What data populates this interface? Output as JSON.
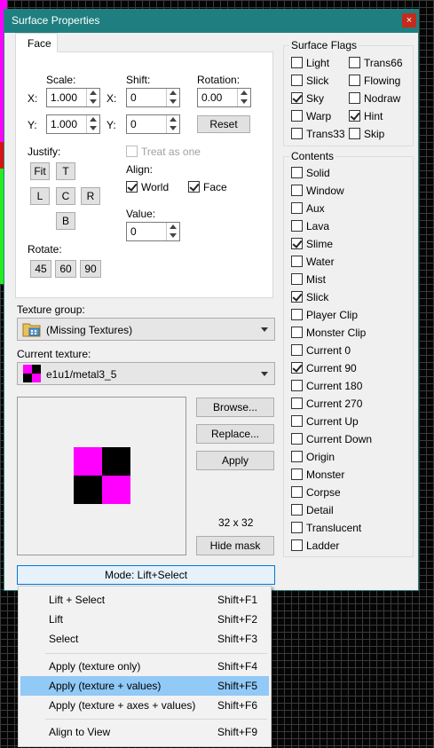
{
  "title": "Surface Properties",
  "close_glyph": "×",
  "tab_face": "Face",
  "scale": {
    "label": "Scale:",
    "x_label": "X:",
    "y_label": "Y:",
    "x_value": "1.000",
    "y_value": "1.000"
  },
  "shift": {
    "label": "Shift:",
    "x_label": "X:",
    "y_label": "Y:",
    "x_value": "0",
    "y_value": "0"
  },
  "rotation": {
    "label": "Rotation:",
    "value": "0.00"
  },
  "reset_label": "Reset",
  "justify": {
    "label": "Justify:",
    "fit": "Fit",
    "t": "T",
    "l": "L",
    "c": "C",
    "r": "R",
    "b": "B"
  },
  "treat_as_one": "Treat as one",
  "align": {
    "label": "Align:",
    "world": "World",
    "face": "Face"
  },
  "value": {
    "label": "Value:",
    "value": "0"
  },
  "rotate": {
    "label": "Rotate:",
    "r45": "45",
    "r60": "60",
    "r90": "90"
  },
  "texture_group": {
    "label": "Texture group:",
    "value": "(Missing Textures)"
  },
  "current_texture": {
    "label": "Current texture:",
    "value": "e1u1/metal3_5"
  },
  "buttons": {
    "browse": "Browse...",
    "replace": "Replace...",
    "apply": "Apply",
    "hide_mask": "Hide mask"
  },
  "texture_size": "32 x 32",
  "mode_button": "Mode: Lift+Select",
  "surface_flags": {
    "title": "Surface Flags",
    "items": [
      {
        "label": "Light",
        "checked": false
      },
      {
        "label": "Trans66",
        "checked": false
      },
      {
        "label": "Slick",
        "checked": false
      },
      {
        "label": "Flowing",
        "checked": false
      },
      {
        "label": "Sky",
        "checked": true
      },
      {
        "label": "Nodraw",
        "checked": false
      },
      {
        "label": "Warp",
        "checked": false
      },
      {
        "label": "Hint",
        "checked": true
      },
      {
        "label": "Trans33",
        "checked": false
      },
      {
        "label": "Skip",
        "checked": false
      }
    ]
  },
  "contents": {
    "title": "Contents",
    "items": [
      {
        "label": "Solid",
        "checked": false
      },
      {
        "label": "Window",
        "checked": false
      },
      {
        "label": "Aux",
        "checked": false
      },
      {
        "label": "Lava",
        "checked": false
      },
      {
        "label": "Slime",
        "checked": true
      },
      {
        "label": "Water",
        "checked": false
      },
      {
        "label": "Mist",
        "checked": false
      },
      {
        "label": "Slick",
        "checked": true
      },
      {
        "label": "Player Clip",
        "checked": false
      },
      {
        "label": "Monster Clip",
        "checked": false
      },
      {
        "label": "Current 0",
        "checked": false
      },
      {
        "label": "Current 90",
        "checked": true
      },
      {
        "label": "Current 180",
        "checked": false
      },
      {
        "label": "Current 270",
        "checked": false
      },
      {
        "label": "Current Up",
        "checked": false
      },
      {
        "label": "Current Down",
        "checked": false
      },
      {
        "label": "Origin",
        "checked": false
      },
      {
        "label": "Monster",
        "checked": false
      },
      {
        "label": "Corpse",
        "checked": false
      },
      {
        "label": "Detail",
        "checked": false
      },
      {
        "label": "Translucent",
        "checked": false
      },
      {
        "label": "Ladder",
        "checked": false
      }
    ]
  },
  "menu": {
    "items": [
      {
        "label": "Lift + Select",
        "shortcut": "Shift+F1"
      },
      {
        "label": "Lift",
        "shortcut": "Shift+F2"
      },
      {
        "label": "Select",
        "shortcut": "Shift+F3"
      },
      {
        "label": "Apply (texture only)",
        "shortcut": "Shift+F4"
      },
      {
        "label": "Apply (texture + values)",
        "shortcut": "Shift+F5"
      },
      {
        "label": "Apply (texture + axes + values)",
        "shortcut": "Shift+F6"
      },
      {
        "label": "Align to View",
        "shortcut": "Shift+F9"
      }
    ]
  },
  "colors": {
    "titlebar": "#1f7f80",
    "texture_magenta": "#ff00ff",
    "texture_black": "#000000",
    "menu_highlight": "#91c9f7"
  },
  "icons": {
    "texture_group": "folder-icon",
    "current_texture": "texture-thumbnail-icon"
  }
}
